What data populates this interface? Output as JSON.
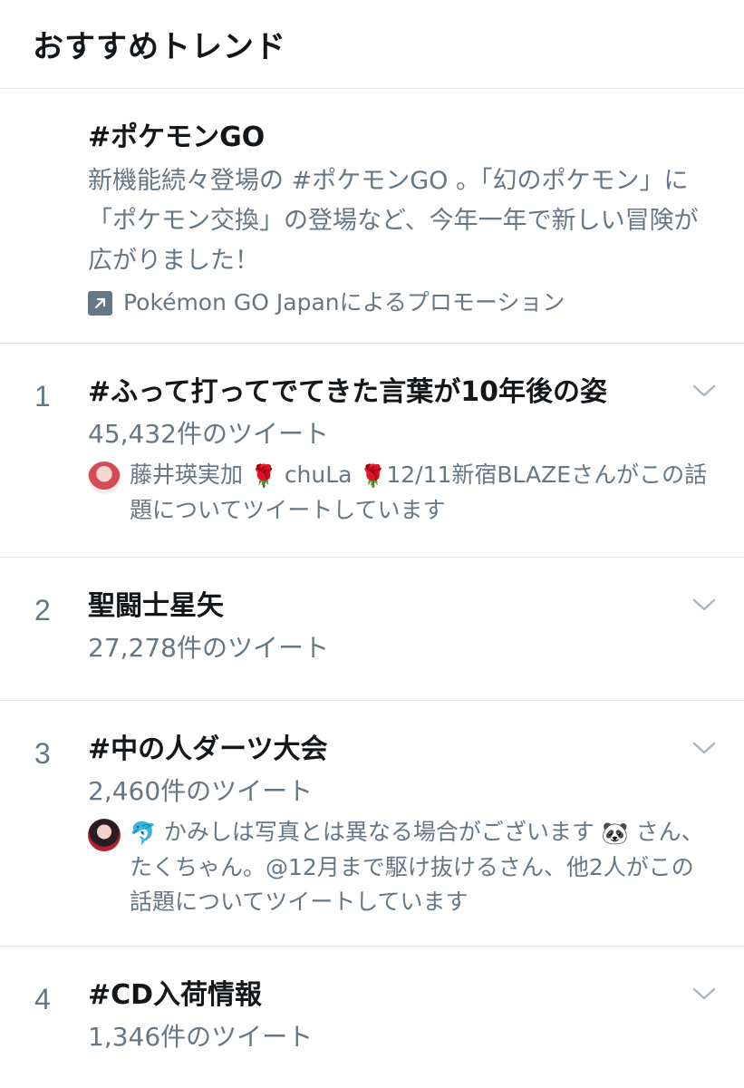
{
  "header": {
    "title": "おすすめトレンド"
  },
  "promo": {
    "title": "#ポケモンGO",
    "description": "新機能続々登場の #ポケモンGO 。「幻のポケモン」に「ポケモン交換」の登場など、今年一年で新しい冒険が広がりました！",
    "attribution": "Pokémon GO Japanによるプロモーション",
    "attribution_icon": "promoted-arrow-icon"
  },
  "trends": [
    {
      "rank": "1",
      "name": "#ふって打ってでてきた言葉が10年後の姿",
      "count": "45,432件のツイート",
      "context": {
        "avatar_icon": "user-avatar",
        "user_name_part1": "藤井瑛実加",
        "user_name_part2": "chuLa",
        "user_name_part3": "12/11新宿BLAZE",
        "suffix": "さんがこの話題についてツイートしています",
        "emoji_icon": "rose-emoji"
      }
    },
    {
      "rank": "2",
      "name": "聖闘士星矢",
      "count": "27,278件のツイート"
    },
    {
      "rank": "3",
      "name": "#中の人ダーツ大会",
      "count": "2,460件のツイート",
      "context": {
        "avatar_icon": "user-avatar",
        "user_name_part1": "かみしは写真とは異なる場合がございます",
        "suffix": "さん、たくちゃん。@12月まで駆け抜けるさん、他2人がこの話題についてツイートしています",
        "emoji_icon_1": "dolphin-emoji",
        "emoji_icon_2": "panda-emoji"
      }
    },
    {
      "rank": "4",
      "name": "#CD入荷情報",
      "count": "1,346件のツイート"
    }
  ],
  "colors": {
    "text_primary": "#14171a",
    "text_secondary": "#657786",
    "divider": "#dfe3e6",
    "chevron": "#aab8c2"
  }
}
